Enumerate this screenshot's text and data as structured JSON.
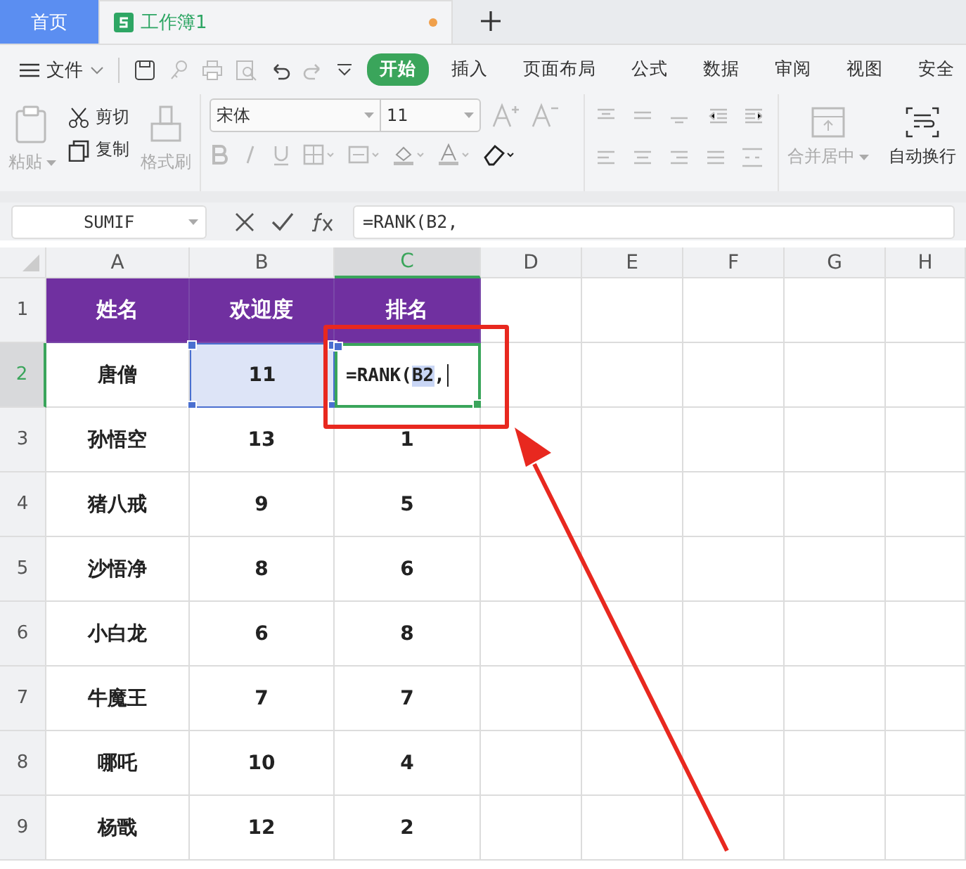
{
  "tabs": [
    {
      "label": "首页",
      "kind": "home",
      "selected": false
    },
    {
      "label": "工作簿1",
      "kind": "doc",
      "selected": true,
      "unsaved": true
    }
  ],
  "menu": {
    "file": "文件",
    "items": [
      {
        "label": "开始",
        "selected": true
      },
      {
        "label": "插入",
        "selected": false
      },
      {
        "label": "页面布局",
        "selected": false
      },
      {
        "label": "公式",
        "selected": false
      },
      {
        "label": "数据",
        "selected": false
      },
      {
        "label": "审阅",
        "selected": false
      },
      {
        "label": "视图",
        "selected": false
      },
      {
        "label": "安全",
        "selected": false
      }
    ]
  },
  "ribbon": {
    "paste": "粘贴",
    "cut": "剪切",
    "copy": "复制",
    "format_painter": "格式刷",
    "font_name": "宋体",
    "font_size": "11",
    "merge": "合并居中",
    "wrap": "自动换行"
  },
  "name_box": "SUMIF",
  "formula": "=RANK(B2,",
  "columns": [
    {
      "label": "A",
      "selected": false
    },
    {
      "label": "B",
      "selected": false
    },
    {
      "label": "C",
      "selected": true
    },
    {
      "label": "D",
      "selected": false
    },
    {
      "label": "E",
      "selected": false
    },
    {
      "label": "F",
      "selected": false
    },
    {
      "label": "G",
      "selected": false
    },
    {
      "label": "H",
      "selected": false
    }
  ],
  "rows": [
    {
      "label": "1",
      "selected": false,
      "cells": [
        {
          "kind": "header",
          "text": "姓名"
        },
        {
          "kind": "header",
          "text": "欢迎度"
        },
        {
          "kind": "header",
          "text": "排名"
        }
      ]
    },
    {
      "label": "2",
      "selected": true,
      "cells": [
        {
          "kind": "plain",
          "text": "唐僧"
        },
        {
          "kind": "reference",
          "text": "11"
        },
        {
          "kind": "editing",
          "parts": [
            {
              "text": "=RANK(",
              "ref": false
            },
            {
              "text": "B2",
              "ref": true
            },
            {
              "text": ",",
              "ref": false
            }
          ]
        }
      ]
    },
    {
      "label": "3",
      "selected": false,
      "cells": [
        {
          "kind": "plain",
          "text": "孙悟空"
        },
        {
          "kind": "plain",
          "text": "13"
        },
        {
          "kind": "plain",
          "text": "1"
        }
      ]
    },
    {
      "label": "4",
      "selected": false,
      "cells": [
        {
          "kind": "plain",
          "text": "猪八戒"
        },
        {
          "kind": "plain",
          "text": "9"
        },
        {
          "kind": "plain",
          "text": "5"
        }
      ]
    },
    {
      "label": "5",
      "selected": false,
      "cells": [
        {
          "kind": "plain",
          "text": "沙悟净"
        },
        {
          "kind": "plain",
          "text": "8"
        },
        {
          "kind": "plain",
          "text": "6"
        }
      ]
    },
    {
      "label": "6",
      "selected": false,
      "cells": [
        {
          "kind": "plain",
          "text": "小白龙"
        },
        {
          "kind": "plain",
          "text": "6"
        },
        {
          "kind": "plain",
          "text": "8"
        }
      ]
    },
    {
      "label": "7",
      "selected": false,
      "cells": [
        {
          "kind": "plain",
          "text": "牛魔王"
        },
        {
          "kind": "plain",
          "text": "7"
        },
        {
          "kind": "plain",
          "text": "7"
        }
      ]
    },
    {
      "label": "8",
      "selected": false,
      "cells": [
        {
          "kind": "plain",
          "text": "哪吒"
        },
        {
          "kind": "plain",
          "text": "10"
        },
        {
          "kind": "plain",
          "text": "4"
        }
      ]
    },
    {
      "label": "9",
      "selected": false,
      "cells": [
        {
          "kind": "plain",
          "text": "杨戬"
        },
        {
          "kind": "plain",
          "text": "12"
        },
        {
          "kind": "plain",
          "text": "2"
        }
      ]
    }
  ]
}
